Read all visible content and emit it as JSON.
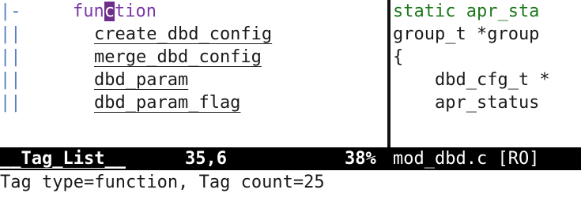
{
  "taglist": {
    "items": [
      {
        "fold": "|-",
        "text_before": "fun",
        "cursor": "c",
        "text_after": "tion",
        "kind": true
      },
      {
        "fold": "||",
        "text": "create_dbd_config"
      },
      {
        "fold": "||",
        "text": "merge_dbd_config"
      },
      {
        "fold": "||",
        "text": "dbd_param"
      },
      {
        "fold": "||",
        "text": "dbd_param_flag"
      }
    ]
  },
  "editor": {
    "lines": [
      {
        "prefix": "|",
        "text": "static apr_sta"
      },
      {
        "prefix": "|",
        "text": "group_t *group"
      },
      {
        "prefix": "|",
        "text": "{"
      },
      {
        "prefix": "|",
        "text": "    dbd_cfg_t *"
      },
      {
        "prefix": "|",
        "text": "    apr_status"
      }
    ]
  },
  "statusbar": {
    "left_title": "__Tag_List__",
    "left_pos": "35,6",
    "left_pct": "38%",
    "right_file": "mod_dbd.c [RO]"
  },
  "cmdline": "Tag type=function, Tag count=25",
  "colors": {
    "kind": "#7a3aa8",
    "cursor_bg": "#6e2f8a",
    "fold": "#5a7fc0",
    "static_keyword": "#1f7a1f",
    "statusbar_bg": "#000000"
  }
}
